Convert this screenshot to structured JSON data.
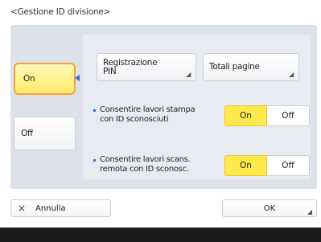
{
  "title": "<Gestione ID divisione>",
  "left_options": {
    "on_label": "On",
    "off_label": "Off",
    "selected": "On"
  },
  "buttons": {
    "pin_label_line1": "Registrazione",
    "pin_label_line2": "PIN",
    "totals_label": "Totali pagine",
    "corner_icon": "◢"
  },
  "settings": [
    {
      "label_line1": "Consentire lavori stampa",
      "label_line2": "con ID sconosciuti",
      "on_label": "On",
      "off_label": "Off",
      "selected": "On"
    },
    {
      "label_line1": "Consentire lavori scans.",
      "label_line2": "remota con ID sconosc.",
      "on_label": "On",
      "off_label": "Off",
      "selected": "On"
    }
  ],
  "footer_buttons": {
    "cancel_icon": "×",
    "cancel_label": "Annulla",
    "ok_label": "OK",
    "ok_corner": "◢"
  },
  "colors": {
    "selected_fill": "#ffe94a",
    "focus_border": "#f4a23c",
    "accent": "#2f73d8",
    "panel": "#dde2ea"
  }
}
